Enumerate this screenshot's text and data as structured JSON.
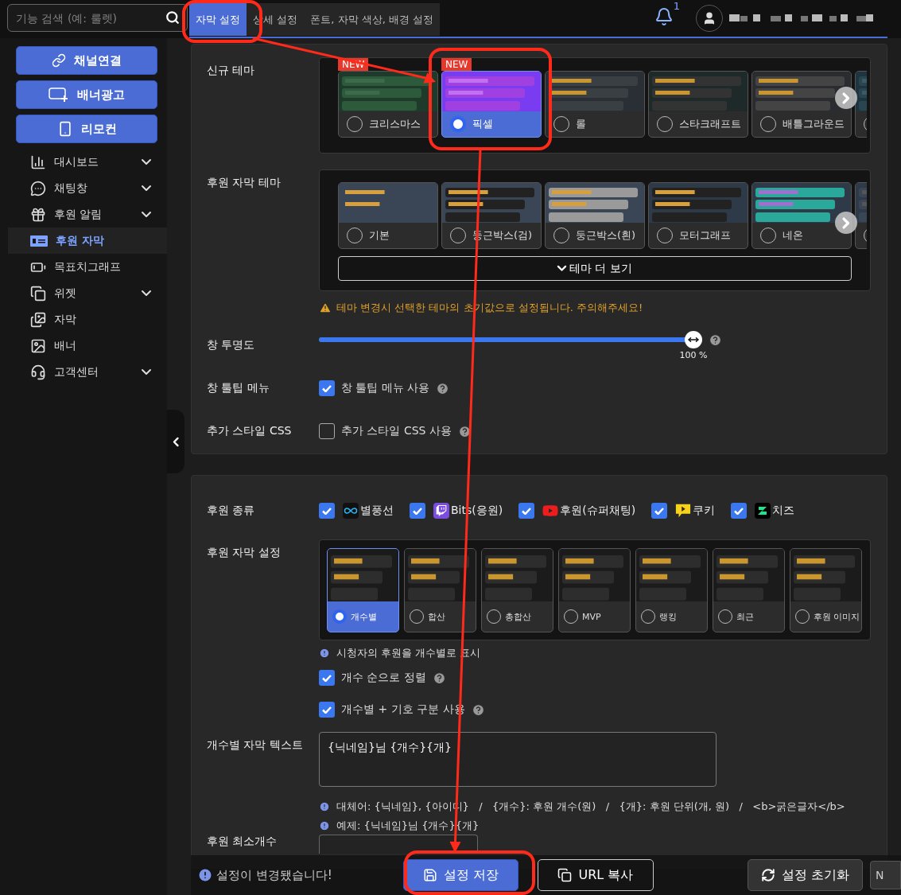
{
  "search": {
    "placeholder": "기능 검색 (예: 룰렛)"
  },
  "tabs": [
    {
      "label": "자막 설정",
      "selected": true
    },
    {
      "label": "상세 설정",
      "selected": false
    },
    {
      "label": "폰트, 자막 색상, 배경 설정",
      "selected": false
    }
  ],
  "notifications": {
    "count": "1"
  },
  "sidebar": {
    "buttons": [
      {
        "label": "채널연결",
        "kind": "link"
      },
      {
        "label": "배너광고",
        "kind": "ad"
      },
      {
        "label": "리모컨",
        "kind": "remote"
      }
    ],
    "items": [
      {
        "label": "대시보드",
        "kind": "dashboard",
        "submenu": true,
        "selected": false
      },
      {
        "label": "채팅창",
        "kind": "chat",
        "submenu": true,
        "selected": false
      },
      {
        "label": "후원 알림",
        "kind": "gift",
        "submenu": true,
        "selected": false
      },
      {
        "label": "후원 자막",
        "kind": "caption",
        "submenu": false,
        "selected": true
      },
      {
        "label": "목표치그래프",
        "kind": "goal",
        "submenu": false,
        "selected": false
      },
      {
        "label": "위젯",
        "kind": "widget",
        "submenu": true,
        "selected": false
      },
      {
        "label": "자막",
        "kind": "media",
        "submenu": false,
        "selected": false
      },
      {
        "label": "배너",
        "kind": "banner",
        "submenu": false,
        "selected": false
      },
      {
        "label": "고객센터",
        "kind": "support",
        "submenu": true,
        "selected": false
      }
    ]
  },
  "theme_settings": {
    "new_theme": {
      "label": "신규 테마",
      "themes": [
        {
          "name": "크리스마스",
          "badge": "NEW",
          "selected": false
        },
        {
          "name": "픽셀",
          "badge": "NEW",
          "selected": true
        },
        {
          "name": "롤",
          "selected": false
        },
        {
          "name": "스타크래프트",
          "selected": false
        },
        {
          "name": "배틀그라운드",
          "selected": false
        },
        {
          "selected": false
        }
      ]
    },
    "donation_theme": {
      "label": "후원 자막 테마",
      "themes": [
        {
          "name": "기본",
          "selected": false
        },
        {
          "name": "둥근박스(검)",
          "selected": false
        },
        {
          "name": "둥근박스(흰)",
          "selected": false
        },
        {
          "name": "모터그래프",
          "selected": false
        },
        {
          "name": "네온",
          "selected": false
        },
        {
          "selected": false
        }
      ],
      "more_button": "테마 더 보기"
    },
    "warning": "테마 변경시 선택한 테마의 초기값으로 설정됩니다. 주의해주세요!",
    "opacity": {
      "label": "창 투명도",
      "level": 1,
      "reading": "100 %"
    },
    "tooltip_menu": {
      "label": "창 툴팁 메뉴",
      "option": "창 툴팁 메뉴 사용",
      "checked": true
    },
    "custom_css": {
      "label": "추가 스타일 CSS",
      "option": "추가 스타일 CSS 사용",
      "checked": false
    }
  },
  "donation_settings": {
    "types_label": "후원 종류",
    "types": [
      {
        "label": "별풍선",
        "kind": "balloon",
        "checked": true
      },
      {
        "label": "Bits(응원)",
        "kind": "bits",
        "checked": true
      },
      {
        "label": "후원(슈퍼채팅)",
        "kind": "superchat",
        "checked": true
      },
      {
        "label": "쿠키",
        "kind": "cookie",
        "checked": true
      },
      {
        "label": "치즈",
        "kind": "cheese",
        "checked": true
      }
    ],
    "styles_label": "후원 자막 설정",
    "styles": [
      {
        "name": "개수별",
        "selected": true
      },
      {
        "name": "합산",
        "selected": false
      },
      {
        "name": "총합산",
        "selected": false
      },
      {
        "name": "MVP",
        "selected": false
      },
      {
        "name": "랭킹",
        "selected": false
      },
      {
        "name": "최근",
        "selected": false
      },
      {
        "name": "후원 이미지",
        "selected": false
      }
    ],
    "style_info": "시청자의 후원을 개수별로 표시",
    "options": [
      {
        "label": "개수 순으로 정렬",
        "checked": true
      },
      {
        "label": "개수별 + 기호 구분 사용",
        "checked": true
      }
    ],
    "text_label": "개수별 자막 텍스트",
    "text_value": "{닉네임}님 {개수}{개}",
    "hints": [
      "대체어: {닉네임}, {아이디}   /   {개수}: 후원 개수(원)   /   {개}: 후원 단위(개, 원)   /   <b>굵은글자</b>",
      "예제: {닉네임}님 {개수}{개}"
    ],
    "min_label": "후원 최소개수"
  },
  "footer": {
    "notice": "설정이 변경됐습니다!",
    "save": "설정 저장",
    "copy_url": "URL 복사",
    "reset": "설정 초기화",
    "cut_button": "N"
  }
}
